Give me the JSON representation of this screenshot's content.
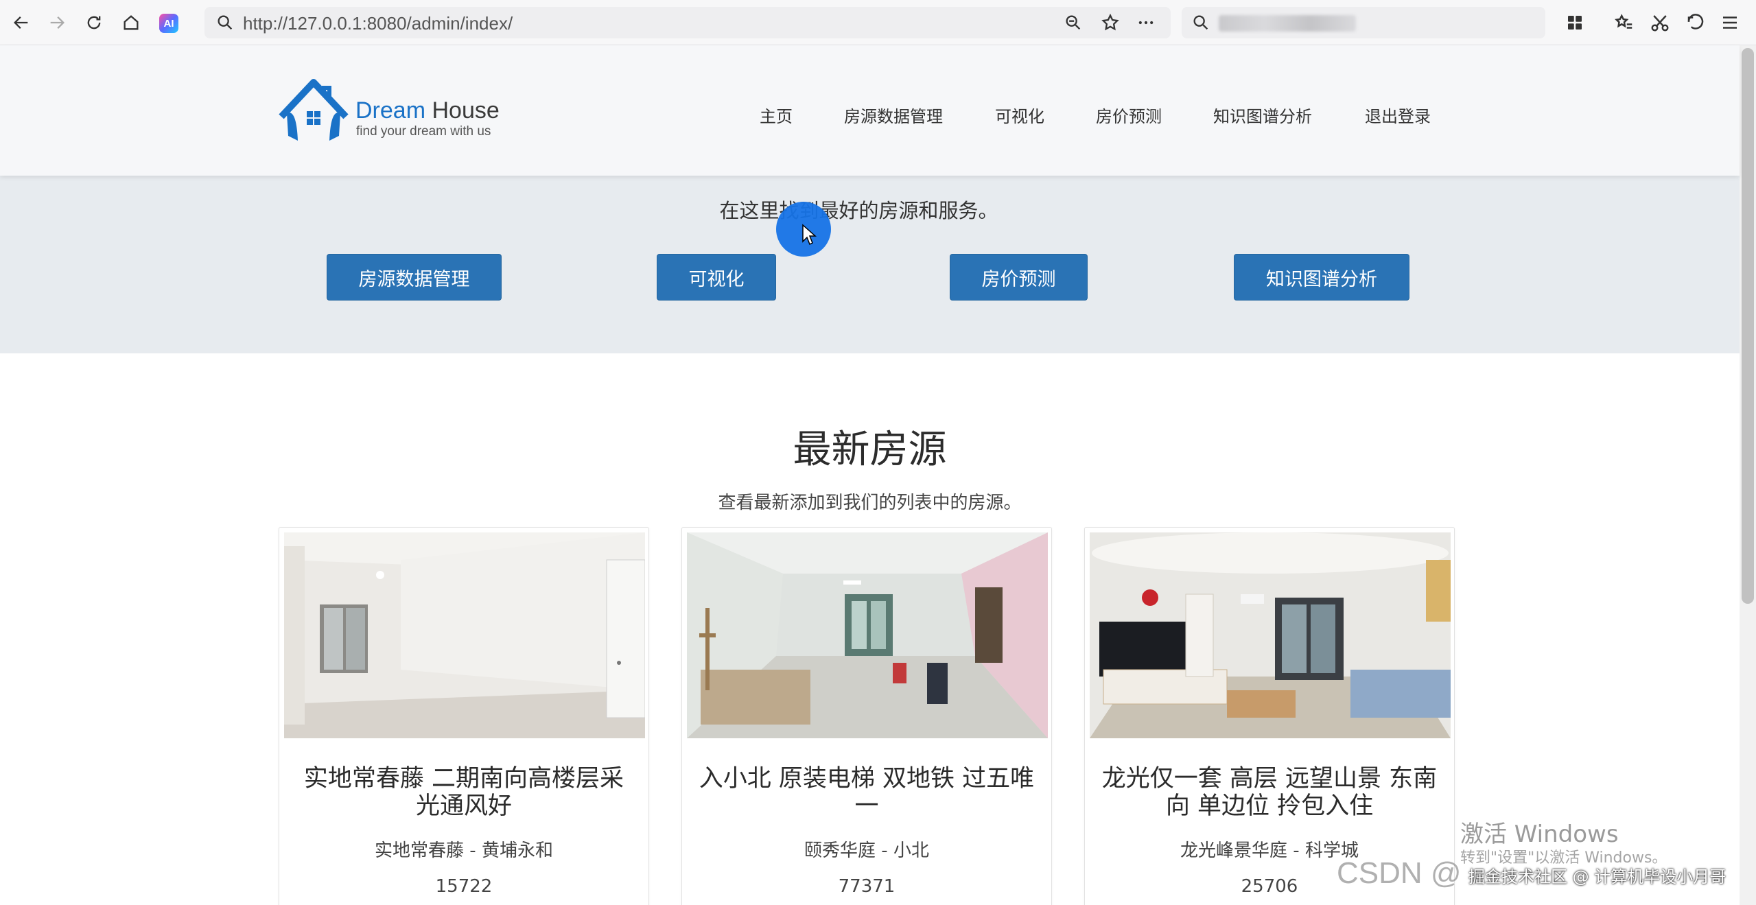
{
  "browser": {
    "url": "http://127.0.0.1:8080/admin/index/",
    "ai_badge": "AI"
  },
  "site": {
    "brand_name_part1": "Dream",
    "brand_name_part2": "House",
    "brand_tagline": "find your dream with us",
    "nav": [
      {
        "label": "主页"
      },
      {
        "label": "房源数据管理"
      },
      {
        "label": "可视化"
      },
      {
        "label": "房价预测"
      },
      {
        "label": "知识图谱分析"
      },
      {
        "label": "退出登录"
      }
    ]
  },
  "hero": {
    "text": "在这里找到最好的房源和服务。",
    "buttons": [
      {
        "label": "房源数据管理"
      },
      {
        "label": "可视化"
      },
      {
        "label": "房价预测"
      },
      {
        "label": "知识图谱分析"
      }
    ]
  },
  "latest": {
    "title": "最新房源",
    "subtitle": "查看最新添加到我们的列表中的房源。",
    "listings": [
      {
        "title": "实地常春藤 二期南向高楼层采光通风好",
        "location": "实地常春藤 - 黄埔永和",
        "price": "15722"
      },
      {
        "title": "入小北 原装电梯 双地铁 过五唯一",
        "location": "颐秀华庭 - 小北",
        "price": "77371"
      },
      {
        "title": "龙光仅一套 高层 远望山景 东南向 单边位 拎包入住",
        "location": "龙光峰景华庭 - 科学城",
        "price": "25706"
      }
    ]
  },
  "overlay": {
    "windows_activate": "激活 Windows",
    "windows_activate_sub": "转到\"设置\"以激活 Windows。",
    "csdn": "CSDN @",
    "juejin": "掘金技术社区 @ 计算机毕设小月哥"
  },
  "colors": {
    "brand_blue": "#1a72c7",
    "button_blue": "#2a73b5",
    "hero_bg": "#e7ebef",
    "header_bg": "#f6f7f9"
  }
}
